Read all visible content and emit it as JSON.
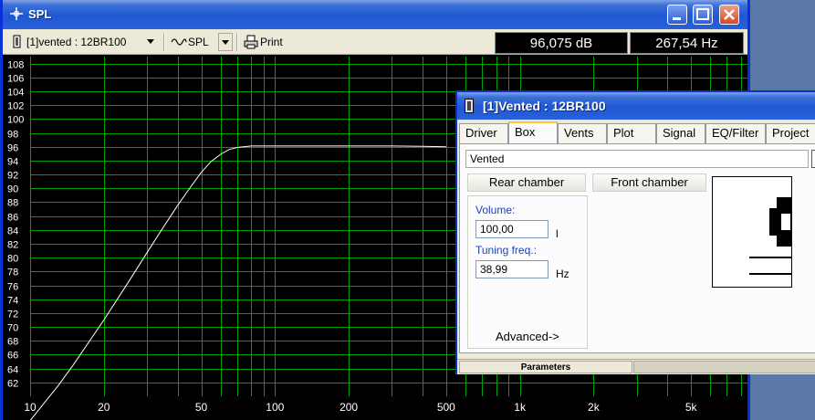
{
  "spl_window": {
    "title": "SPL",
    "toolbar": {
      "driver_select": "[1]vented : 12BR100",
      "plot_select": "SPL",
      "print_label": "Print"
    },
    "readouts": {
      "level": "96,075 dB",
      "frequency": "267,54 Hz"
    }
  },
  "chart_data": {
    "type": "line",
    "y_ticks": [
      "108",
      "106",
      "104",
      "102",
      "100",
      "98",
      "96",
      "94",
      "92",
      "90",
      "88",
      "86",
      "84",
      "82",
      "80",
      "78",
      "76",
      "74",
      "72",
      "70",
      "68",
      "66",
      "64",
      "62"
    ],
    "x_ticks": [
      "10",
      "20",
      "50",
      "100",
      "200",
      "500",
      "1k",
      "2k",
      "5k"
    ],
    "xlim": [
      10,
      8500
    ],
    "ylim": [
      60,
      109
    ],
    "x_scale": "log",
    "grid": true,
    "colors": {
      "background": "#000000",
      "grid": "#00a000",
      "curve": "#ffffff",
      "labels": "#ffffff"
    },
    "x": [
      10,
      13,
      15,
      20,
      25,
      30,
      35,
      40,
      45,
      50,
      55,
      60,
      65,
      70,
      80,
      90,
      100,
      150,
      200,
      300,
      400,
      500
    ],
    "y": [
      56.5,
      61.5,
      64.5,
      71.0,
      76.3,
      80.7,
      84.4,
      87.5,
      90.1,
      92.3,
      93.9,
      94.9,
      95.6,
      95.9,
      96.1,
      96.1,
      96.1,
      96.1,
      96.1,
      96.1,
      96.05,
      96.0
    ]
  },
  "vented_dialog": {
    "title": "[1]Vented : 12BR100",
    "tabs": [
      "Driver",
      "Box",
      "Vents",
      "Plot",
      "Signal",
      "EQ/Filter",
      "Project"
    ],
    "active_tab": "Box",
    "box_type": "Vented",
    "rear_chamber_button": "Rear chamber",
    "front_chamber_button": "Front chamber",
    "volume_label": "Volume:",
    "volume_value": "100,00",
    "volume_unit": "l",
    "tuning_label": "Tuning freq.:",
    "tuning_value": "38,99",
    "tuning_unit": "Hz",
    "advanced_button": "Advanced->",
    "status_label": "Parameters"
  }
}
